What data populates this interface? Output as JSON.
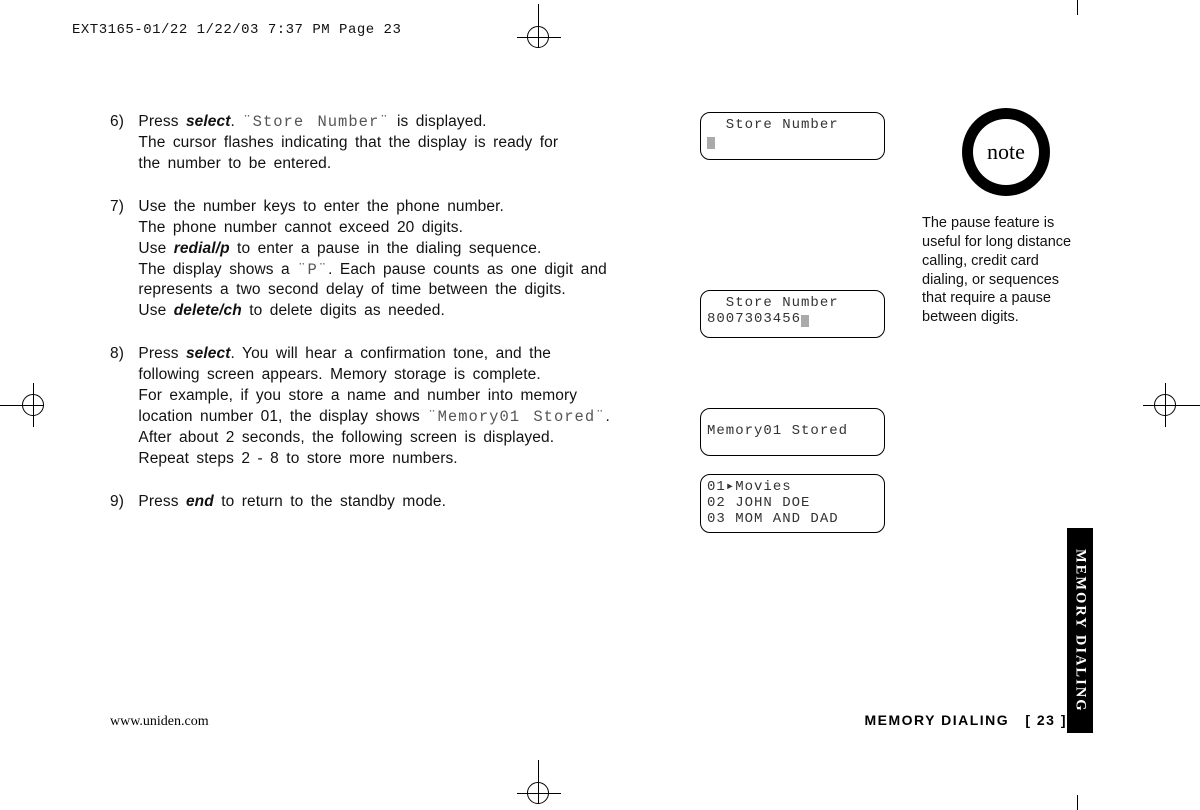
{
  "header_line": "EXT3165-01/22  1/22/03  7:37 PM  Page 23",
  "steps": {
    "s6": {
      "num": "6)",
      "l1a": "Press ",
      "key": "select",
      "l1b": ". ",
      "lcd_quote": "¨Store Number¨",
      "l1c": " is displayed.",
      "l2": "The cursor flashes indicating that the display is ready for",
      "l3": "the number to be entered."
    },
    "s7": {
      "num": "7)",
      "l1": "Use the number keys to enter the phone number.",
      "l2": "The phone number cannot exceed 20 digits.",
      "l3a": "Use ",
      "key1": "redial/p",
      "l3b": " to enter a pause in the dialing sequence.",
      "l4a": "The display shows a ",
      "lcd_quote": "¨P¨",
      "l4b": ". Each pause counts as one digit and",
      "l5": "represents a two second delay of time between the digits.",
      "l6a": "Use ",
      "key2": "delete/ch",
      "l6b": " to delete digits as needed."
    },
    "s8": {
      "num": "8)",
      "l1a": "Press ",
      "key": "select",
      "l1b": ". You will hear a confirmation tone, and the",
      "l2": "following screen appears. Memory storage is complete.",
      "l3": "For example, if you store a name and number into memory",
      "l4a": "location number 01, the display shows ",
      "lcd_quote": "¨Memory01 Stored¨",
      "l4b": ".",
      "l5": "After about 2 seconds, the following screen is displayed.",
      "l6": "Repeat steps 2 - 8 to store more numbers."
    },
    "s9": {
      "num": "9)",
      "l1a": "Press ",
      "key": "end",
      "l1b": " to return to the standby mode."
    }
  },
  "lcd_screens": {
    "a_line1": "  Store Number",
    "b_line1": "  Store Number",
    "b_line2": "8007303456",
    "c_line1": "Memory01 Stored",
    "d_line1": "01▸Movies",
    "d_line2": "02 JOHN DOE",
    "d_line3": "03 MOM AND DAD"
  },
  "note": {
    "label": "note",
    "text_l1": "The pause feature is",
    "text_l2": "useful for long distance",
    "text_l3": "calling, credit card",
    "text_l4": "dialing, or sequences",
    "text_l5": "that require a pause",
    "text_l6": "between digits."
  },
  "footer": {
    "url": "www.uniden.com",
    "section": "MEMORY DIALING",
    "page": "[ 23 ]"
  },
  "side_tab": "MEMORY DIALING"
}
